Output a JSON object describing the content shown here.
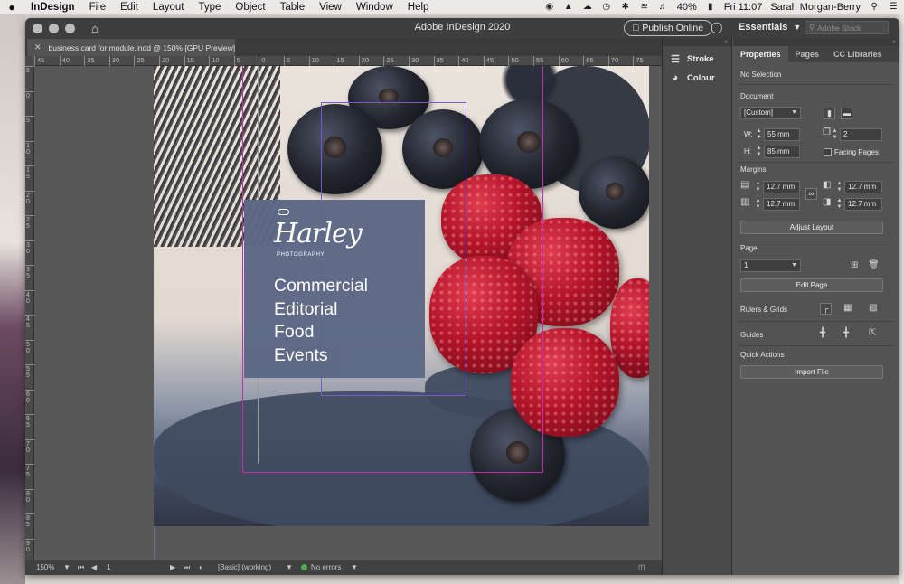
{
  "menubar": {
    "apple": "",
    "app_name": "InDesign",
    "items": [
      "File",
      "Edit",
      "Layout",
      "Type",
      "Object",
      "Table",
      "View",
      "Window",
      "Help"
    ],
    "battery": "40%",
    "clock": "Fri 11:07",
    "user": "Sarah Morgan-Berry"
  },
  "window": {
    "title": "Adobe InDesign 2020",
    "publish_label": "Publish Online",
    "workspace": "Essentials",
    "stock_placeholder": "Adobe Stock",
    "doc_tab": "business card for module.indd @ 150% [GPU Preview]"
  },
  "rulers": {
    "h_labels": [
      "45",
      "40",
      "35",
      "30",
      "25",
      "20",
      "15",
      "10",
      "5",
      "0",
      "5",
      "10",
      "15",
      "20",
      "25",
      "30",
      "35",
      "40",
      "45",
      "50",
      "55",
      "60",
      "65",
      "70",
      "75"
    ],
    "v_labels": [
      "5",
      "0",
      "5",
      "10",
      "15",
      "20",
      "25",
      "30",
      "35",
      "40",
      "45",
      "50",
      "55",
      "60",
      "65",
      "70",
      "75",
      "80",
      "85",
      "90",
      "95"
    ]
  },
  "card": {
    "logo": "Harley",
    "logo_sub": "PHOTOGRAPHY",
    "services": [
      "Commercial",
      "Editorial",
      "Food",
      "Events"
    ]
  },
  "statusbar": {
    "zoom": "150%",
    "page": "1",
    "profile": "[Basic] (working)",
    "errors": "No errors"
  },
  "dock": {
    "stroke": "Stroke",
    "colour": "Colour"
  },
  "properties": {
    "tabs": [
      "Properties",
      "Pages",
      "CC Libraries"
    ],
    "selection": "No Selection",
    "document_label": "Document",
    "preset": "[Custom]",
    "w_label": "W:",
    "w_value": "55 mm",
    "h_label": "H:",
    "h_value": "85 mm",
    "pages_count": "2",
    "facing_pages": "Facing Pages",
    "margins_label": "Margins",
    "margin_top": "12.7 mm",
    "margin_bottom": "12.7 mm",
    "margin_left": "12.7 mm",
    "margin_right": "12.7 mm",
    "adjust_layout": "Adjust Layout",
    "page_label": "Page",
    "page_value": "1",
    "edit_page": "Edit Page",
    "rulers_grids": "Rulers & Grids",
    "guides": "Guides",
    "quick_actions": "Quick Actions",
    "import_file": "Import File"
  }
}
